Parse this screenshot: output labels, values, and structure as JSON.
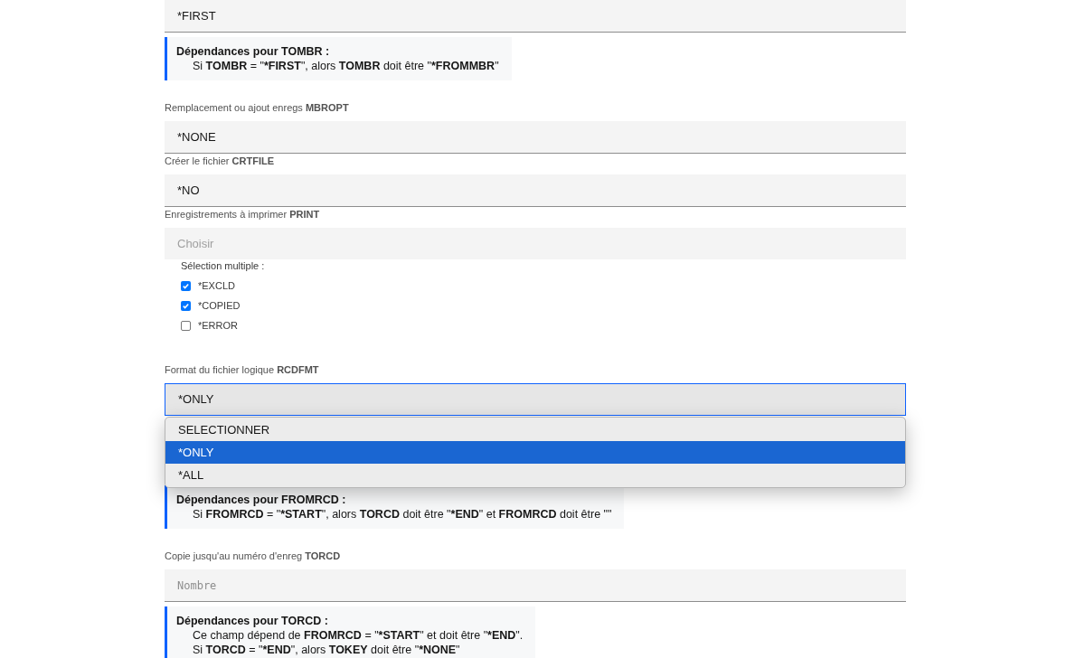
{
  "form": [
    {
      "kind": "field",
      "value": "*FIRST"
    },
    {
      "kind": "dependency",
      "title": "Dépendances pour TOMBR :",
      "lines": [
        "Si **TOMBR** = \"***FIRST**\", alors **TOMBR** doit être \"***FROMMBR**\""
      ]
    },
    {
      "kind": "label",
      "text": "Remplacement ou ajout enregs **MBROPT**"
    },
    {
      "kind": "field",
      "value": "*NONE"
    },
    {
      "kind": "label",
      "text": "Créer le fichier **CRTFILE**"
    },
    {
      "kind": "field",
      "value": "*NO"
    },
    {
      "kind": "label",
      "text": "Enregistrements à imprimer **PRINT**"
    },
    {
      "kind": "multiselect",
      "placeholder": "Choisir",
      "caption": "Sélection multiple :",
      "options": [
        {
          "label": "*EXCLD",
          "checked": true
        },
        {
          "label": "*COPIED",
          "checked": true
        },
        {
          "label": "*ERROR",
          "checked": false
        }
      ]
    },
    {
      "kind": "label",
      "text": "Format du fichier logique **RCDFMT**"
    },
    {
      "kind": "select",
      "value": "*ONLY",
      "expanded": true,
      "options": [
        {
          "label": "SELECTIONNER",
          "selected": false
        },
        {
          "label": "*ONLY",
          "selected": true
        },
        {
          "label": "*ALL",
          "selected": false
        }
      ]
    },
    {
      "kind": "dependency",
      "title": "Dépendances pour FROMRCD :",
      "lines": [
        "Si **FROMRCD** = \"***START**\", alors **TORCD** doit être \"***END**\" et **FROMRCD** doit être \"\""
      ]
    },
    {
      "kind": "label",
      "text": "Copie jusqu'au numéro d'enreg **TORCD**"
    },
    {
      "kind": "field",
      "placeholder": "Nombre"
    },
    {
      "kind": "dependency",
      "title": "Dépendances pour TORCD :",
      "lines": [
        "Ce champ dépend de **FROMRCD** = \"***START**\" et doit être \"***END**\".",
        "Si **TORCD** = \"***END**\", alors **TOKEY** doit être \"***NONE**\""
      ]
    }
  ]
}
